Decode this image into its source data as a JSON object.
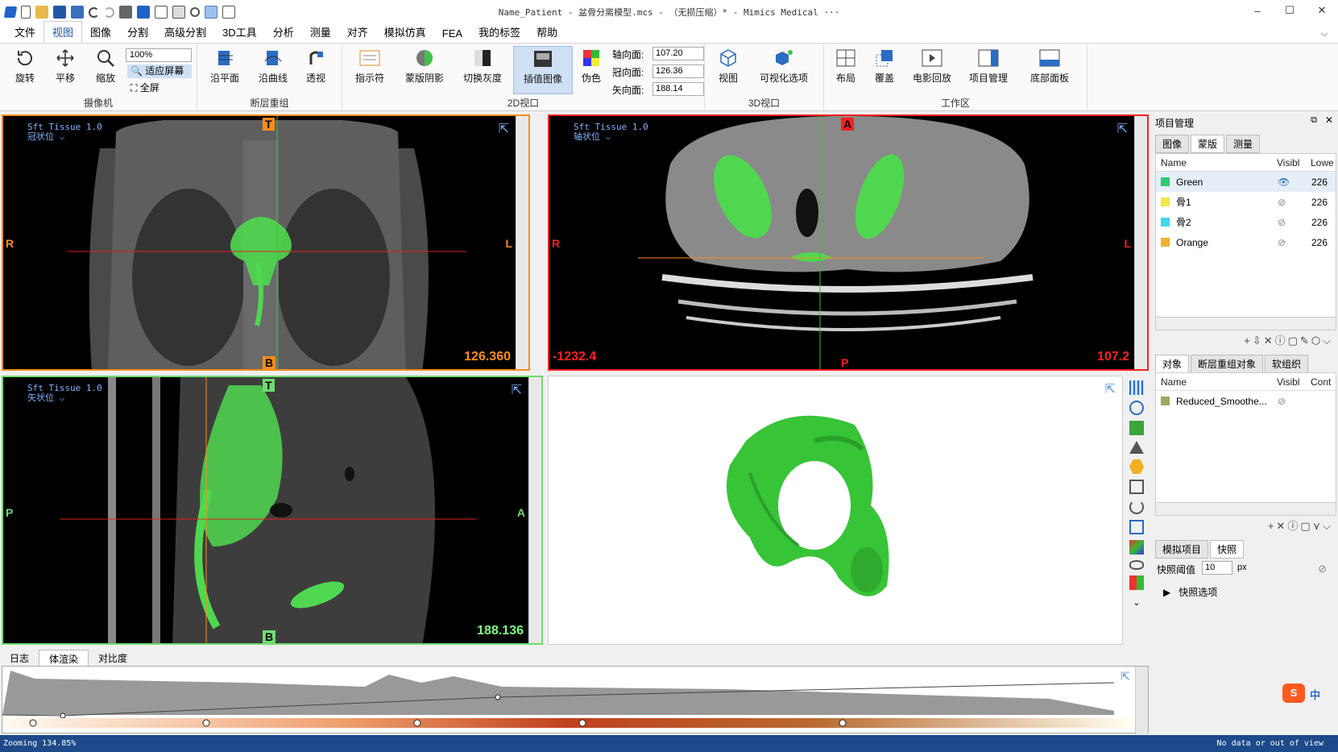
{
  "window": {
    "title": "Name_Patient - 盆骨分离模型.mcs - （无损压缩）* - Mimics Medical ···",
    "minimize": "–",
    "maximize": "☐",
    "close": "✕"
  },
  "menu": [
    "文件",
    "视图",
    "图像",
    "分割",
    "高级分割",
    "3D工具",
    "分析",
    "测量",
    "对齐",
    "模拟仿真",
    "FEA",
    "我的标签",
    "帮助"
  ],
  "ribbon": {
    "camera": {
      "rotate": "旋转",
      "pan": "平移",
      "zoom": "缩放",
      "zoom_value": "100%",
      "fit": "适应屏幕",
      "full": "全屏",
      "label": "摄像机"
    },
    "reslice": {
      "plane": "沿平面",
      "curve": "沿曲线",
      "persp": "透视",
      "label": "断层重组"
    },
    "view2d": {
      "indicator": "指示符",
      "mask_shadow": "蒙版阴影",
      "gray": "切换灰度",
      "interp": "插值图像",
      "pseudo": "伪色",
      "axial_lbl": "轴向面:",
      "axial": "107.20",
      "coronal_lbl": "冠向面:",
      "coronal": "126.36",
      "sagittal_lbl": "矢向面:",
      "sagittal": "188.14",
      "label": "2D视口"
    },
    "view3d": {
      "view": "视图",
      "vis": "可视化选项",
      "label": "3D视口"
    },
    "workspace": {
      "layout": "布局",
      "overlay": "覆盖",
      "cine": "电影回放",
      "project": "项目管理",
      "bottom": "底部面板",
      "label": "工作区"
    }
  },
  "viewports": {
    "coronal": {
      "preset": "Sft Tissue 1.0",
      "name": "冠状位",
      "top": "T",
      "bottom": "B",
      "left": "R",
      "right": "L",
      "value": "126.360",
      "color": "#ff8c1a"
    },
    "axial": {
      "preset": "Sft Tissue 1.0",
      "name": "轴状位",
      "top": "A",
      "bottom": "P",
      "left": "R",
      "right": "L",
      "value": "107.2",
      "leftval": "-1232.4",
      "color": "#ff2020"
    },
    "sagittal": {
      "preset": "Sft Tissue 1.0",
      "name": "矢状位",
      "top": "T",
      "bottom": "B",
      "left": "P",
      "right": "A",
      "value": "188.136",
      "color": "#7dff7d"
    }
  },
  "project": {
    "title": "项目管理",
    "tabs": [
      "图像",
      "蒙版",
      "测量"
    ],
    "columns": [
      "Name",
      "Visibl",
      "Lowe"
    ],
    "masks": [
      {
        "name": "Green",
        "color": "#2ecc71",
        "visible": true,
        "low": "226"
      },
      {
        "name": "骨1",
        "color": "#f4e842",
        "visible": false,
        "low": "226"
      },
      {
        "name": "骨2",
        "color": "#40d8f0",
        "visible": false,
        "low": "226"
      },
      {
        "name": "Orange",
        "color": "#f0b030",
        "visible": false,
        "low": "226"
      }
    ],
    "tabs2": [
      "对象",
      "断层重组对象",
      "软组织"
    ],
    "columns2": [
      "Name",
      "Visibl",
      "Cont"
    ],
    "objects": [
      {
        "name": "Reduced_Smoothe...",
        "color": "#9aaa60"
      }
    ],
    "tabs3": [
      "模拟项目",
      "快照"
    ],
    "snap_label": "快照阈值",
    "snap_value": "10",
    "snap_unit": "px",
    "snap_options": "快照选项"
  },
  "bottom": {
    "tabs": [
      "日志",
      "体渲染",
      "对比度"
    ]
  },
  "status": {
    "left": "Zooming 134.85%",
    "right": "No data or out of view"
  },
  "ime": "中"
}
